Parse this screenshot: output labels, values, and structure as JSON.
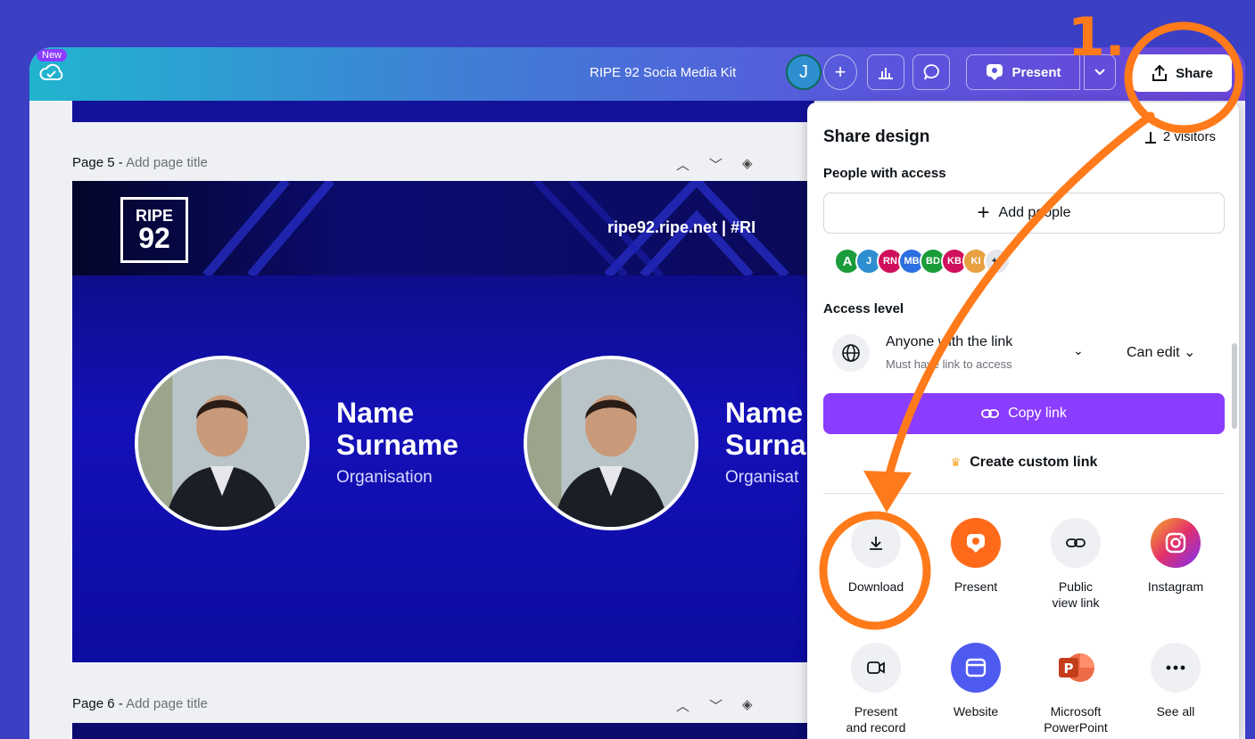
{
  "topbar": {
    "new_badge": "New",
    "doc_title": "RIPE 92 Socia Media Kit",
    "user_initial": "J",
    "add_label": "+",
    "present_label": "Present",
    "share_label": "Share"
  },
  "pages": [
    {
      "label": "Page 5 -",
      "subtitle": "Add page title"
    },
    {
      "label": "Page 6 -",
      "subtitle": "Add page title"
    }
  ],
  "slide": {
    "logo_line1": "RIPE",
    "logo_line2": "92",
    "url": "ripe92.ripe.net  |  #RI",
    "card1": {
      "name_line1": "Name",
      "name_line2": "Surname",
      "org": "Organisation"
    },
    "card2": {
      "name_line1": "Name",
      "name_line2": "Surna",
      "org": "Organisat"
    }
  },
  "share_panel": {
    "title": "Share design",
    "visitors": "2 visitors",
    "people_label": "People with access",
    "add_people": "Add people",
    "avatars": [
      {
        "text": "A",
        "color": "#1a9c3a"
      },
      {
        "text": "J",
        "color": "#2e8fd0"
      },
      {
        "text": "RN",
        "color": "#d0105c"
      },
      {
        "text": "MB",
        "color": "#2c6fe0"
      },
      {
        "text": "BD",
        "color": "#1a9c3a"
      },
      {
        "text": "KB",
        "color": "#d0105c"
      },
      {
        "text": "KI",
        "color": "#e8a040"
      },
      {
        "text": "+1",
        "color": "#e4e6ea"
      }
    ],
    "access_label": "Access level",
    "access_main": "Anyone with the link",
    "access_sub": "Must have link to access",
    "permission": "Can edit",
    "copy_link": "Copy link",
    "custom_link": "Create custom link",
    "options": [
      {
        "label1": "Download",
        "label2": "",
        "icon": "download-icon",
        "bg": "#eef0f3"
      },
      {
        "label1": "Present",
        "label2": "",
        "icon": "present-icon",
        "bg": "#ff6a1a"
      },
      {
        "label1": "Public",
        "label2": "view link",
        "icon": "link-icon",
        "bg": "#eef0f3"
      },
      {
        "label1": "Instagram",
        "label2": "",
        "icon": "instagram-icon",
        "bg": "#e1306c"
      },
      {
        "label1": "Present",
        "label2": "and record",
        "icon": "record-icon",
        "bg": "#eef0f3"
      },
      {
        "label1": "Website",
        "label2": "",
        "icon": "website-icon",
        "bg": "#4f5bf0"
      },
      {
        "label1": "Microsoft",
        "label2": "PowerPoint",
        "icon": "powerpoint-icon",
        "bg": "#ffffff"
      },
      {
        "label1": "See all",
        "label2": "",
        "icon": "more-icon",
        "bg": "#eef0f3"
      }
    ]
  },
  "annotation": {
    "step": "1.",
    "color": "#ff7a1a"
  }
}
